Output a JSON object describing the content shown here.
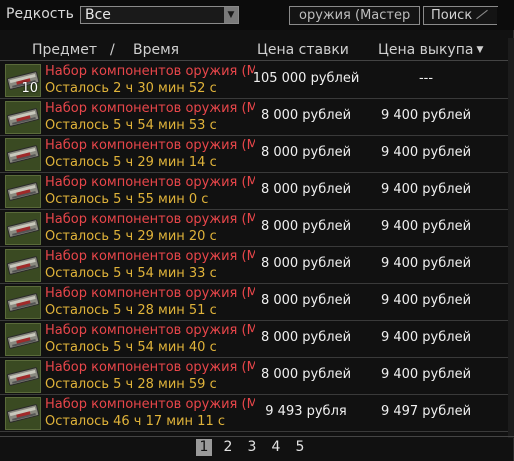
{
  "filters": {
    "rarity_label": "Редкость",
    "rarity_value": "Все",
    "search_value": "оружия (Мастер",
    "search_button": "Поиск"
  },
  "columns": {
    "item": "Предмет",
    "separator": "/",
    "time": "Время",
    "bid": "Цена ставки",
    "buyout": "Цена выкупа",
    "buyout_sort": "▼"
  },
  "rows": [
    {
      "name": "Набор компонентов оружия (Мастер",
      "time": "Осталось 2 ч 30 мин 52 с",
      "bid": "105 000 рублей",
      "buyout": "---",
      "count": "10"
    },
    {
      "name": "Набор компонентов оружия (Мастер",
      "time": "Осталось 5 ч 54 мин 53 с",
      "bid": "8 000 рублей",
      "buyout": "9 400 рублей",
      "count": ""
    },
    {
      "name": "Набор компонентов оружия (Мастер",
      "time": "Осталось 5 ч 29 мин 14 с",
      "bid": "8 000 рублей",
      "buyout": "9 400 рублей",
      "count": ""
    },
    {
      "name": "Набор компонентов оружия (Мастер",
      "time": "Осталось 5 ч 55 мин 0 с",
      "bid": "8 000 рублей",
      "buyout": "9 400 рублей",
      "count": ""
    },
    {
      "name": "Набор компонентов оружия (Мастер",
      "time": "Осталось 5 ч 29 мин 20 с",
      "bid": "8 000 рублей",
      "buyout": "9 400 рублей",
      "count": ""
    },
    {
      "name": "Набор компонентов оружия (Мастер",
      "time": "Осталось 5 ч 54 мин 33 с",
      "bid": "8 000 рублей",
      "buyout": "9 400 рублей",
      "count": ""
    },
    {
      "name": "Набор компонентов оружия (Мастер",
      "time": "Осталось 5 ч 28 мин 51 с",
      "bid": "8 000 рублей",
      "buyout": "9 400 рублей",
      "count": ""
    },
    {
      "name": "Набор компонентов оружия (Мастер",
      "time": "Осталось 5 ч 54 мин 40 с",
      "bid": "8 000 рублей",
      "buyout": "9 400 рублей",
      "count": ""
    },
    {
      "name": "Набор компонентов оружия (Мастер",
      "time": "Осталось 5 ч 28 мин 59 с",
      "bid": "8 000 рублей",
      "buyout": "9 400 рублей",
      "count": ""
    },
    {
      "name": "Набор компонентов оружия (Мастер",
      "time": "Осталось 46 ч 17 мин 11 с",
      "bid": "9 493 рубля",
      "buyout": "9 497 рублей",
      "count": ""
    }
  ],
  "pagination": {
    "pages": [
      "1",
      "2",
      "3",
      "4",
      "5"
    ],
    "current": "1"
  },
  "colors": {
    "item_name": "#e8464a",
    "time_left": "#e0b33a",
    "thumb_bg": "#3a4a22"
  },
  "icons": {
    "item_thumb": "weapon-parts-kit-icon",
    "select_arrow": "chevron-down-icon",
    "sort": "sort-down-icon"
  }
}
